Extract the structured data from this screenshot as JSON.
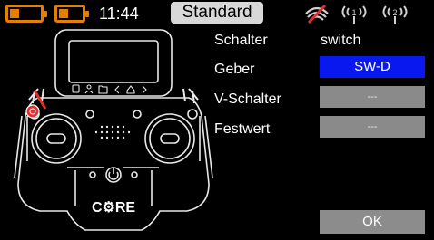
{
  "status": {
    "time": "11:44",
    "mode": "Standard",
    "colors": {
      "battery": "#e67e00",
      "telemetry_off": "#e03030"
    },
    "icons": [
      "battery-tx-icon",
      "battery-rx-icon",
      "no-telemetry-icon",
      "antenna-1-icon",
      "antenna-2-icon"
    ]
  },
  "controller": {
    "brand": "C⚙RE",
    "screen_icons": [
      "book-icon",
      "person-icon",
      "folder-icon",
      "back-icon",
      "home-icon",
      "forward-icon"
    ]
  },
  "form": {
    "rows": [
      {
        "label": "Schalter",
        "value": "switch"
      },
      {
        "label": "Geber",
        "value": "SW-D"
      },
      {
        "label": "V-Schalter",
        "value": "---"
      },
      {
        "label": "Festwert",
        "value": "---"
      }
    ],
    "ok_label": "OK",
    "colors": {
      "selected": "#0a18f0",
      "button": "#8a8a8a"
    }
  }
}
